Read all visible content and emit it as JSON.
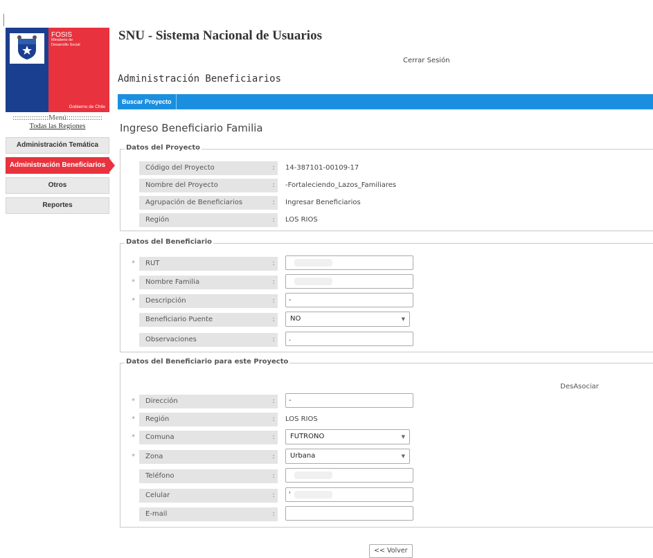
{
  "header": {
    "app_title": "SNU - Sistema Nacional de Usuarios",
    "logout": "Cerrar Sesión",
    "section_title": "Administración Beneficiarios"
  },
  "logo": {
    "brand": "FOSIS",
    "ministry_line1": "Ministerio de",
    "ministry_line2": "Desarrollo Social",
    "government": "Gobierno de Chile"
  },
  "sidebar": {
    "menu_title": ":::::::::::::::::Menú:::::::::::::::::",
    "all_regions": "Todas las Regiones",
    "items": [
      {
        "label": "Administración Temática",
        "active": false
      },
      {
        "label": "Administración Beneficiarios",
        "active": true
      },
      {
        "label": "Otros",
        "active": false
      },
      {
        "label": "Reportes",
        "active": false
      }
    ]
  },
  "toolbar": {
    "tab_label": "Buscar Proyecto",
    "color": "#1a8fe0"
  },
  "page_title": "Ingreso Beneficiario Familia",
  "project": {
    "legend": "Datos del Proyecto",
    "rows": [
      {
        "label": "Código del Proyecto",
        "value": "14-387101-00109-17"
      },
      {
        "label": "Nombre del Proyecto",
        "value": "-Fortaleciendo_Lazos_Familiares"
      },
      {
        "label": "Agrupación de Beneficiarios",
        "value": "Ingresar Beneficiarios"
      },
      {
        "label": "Región",
        "value": "LOS RIOS"
      }
    ]
  },
  "beneficiary": {
    "legend": "Datos del Beneficiario",
    "rut_label": "RUT",
    "family_label": "Nombre Familia",
    "family_value": "",
    "description_label": "Descripción",
    "description_value": "-",
    "bridge_label": "Beneficiario Puente",
    "bridge_value": "NO",
    "observations_label": "Observaciones",
    "observations_value": "."
  },
  "project_beneficiary": {
    "legend": "Datos del Beneficiario para este Proyecto",
    "desasociar": "DesAsociar",
    "address_label": "Dirección",
    "address_value": "-",
    "region_label": "Región",
    "region_value": "LOS RIOS",
    "comuna_label": "Comuna",
    "comuna_value": "FUTRONO",
    "zona_label": "Zona",
    "zona_value": "Urbana",
    "phone_label": "Teléfono",
    "mobile_label": "Celular",
    "mobile_value": "'",
    "email_label": "E-mail"
  },
  "buttons": {
    "back": "<< Volver"
  },
  "colors": {
    "accent_red": "#e8323e",
    "brand_blue": "#1b3f8f"
  }
}
